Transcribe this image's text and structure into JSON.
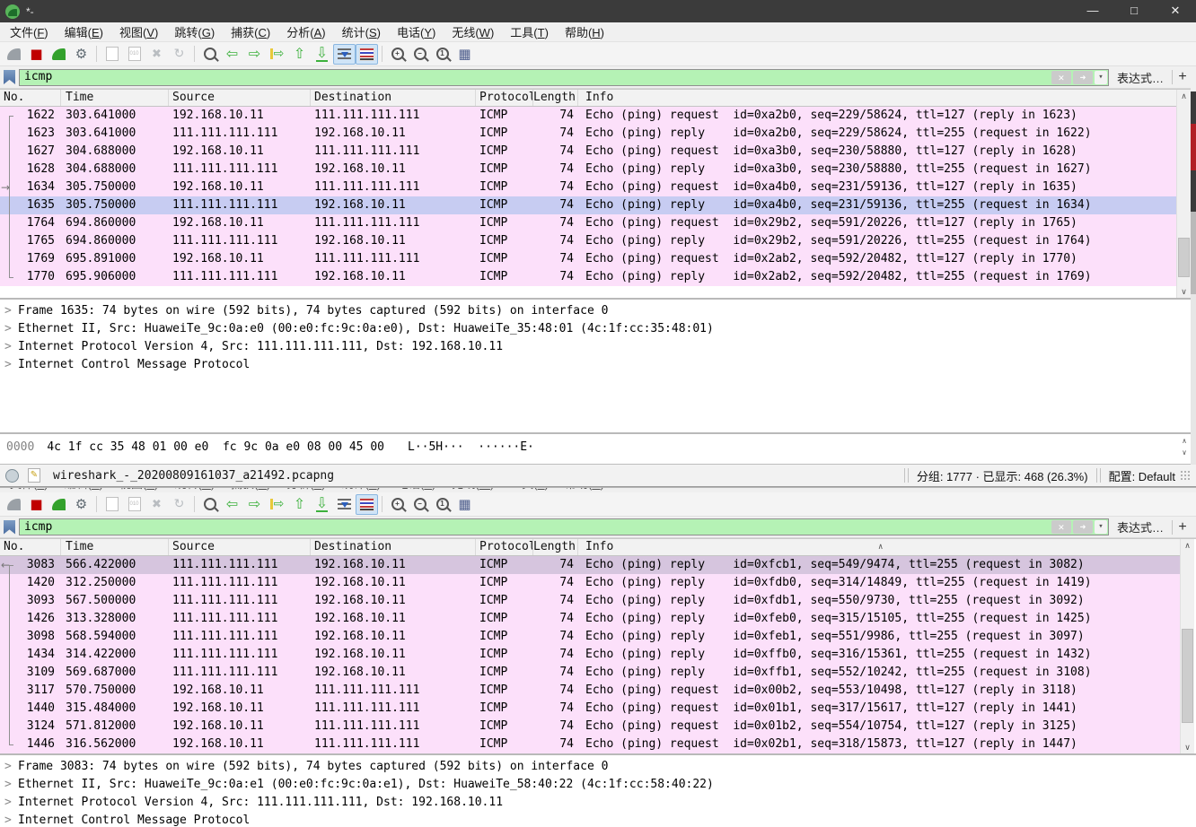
{
  "colors": {
    "filter_valid_bg": "#b5f2b5",
    "icmp_row_bg": "#fce0fa",
    "selected_row_bg": "#c7ccf2",
    "inactive_selected_row_bg": "#d6c5de",
    "titlebar_bg": "#3b3b3b"
  },
  "shared": {
    "menu": [
      "文件(F)",
      "编辑(E)",
      "视图(V)",
      "跳转(G)",
      "捕获(C)",
      "分析(A)",
      "统计(S)",
      "电话(Y)",
      "无线(W)",
      "工具(T)",
      "帮助(H)"
    ],
    "toolbar": [
      {
        "name": "start-capture-icon",
        "type": "fin",
        "color": "#9aa0a6"
      },
      {
        "name": "stop-capture-icon",
        "type": "glyph",
        "glyph": "■",
        "color": "#c00000",
        "size": 15
      },
      {
        "name": "restart-capture-icon",
        "type": "fin",
        "color": "#33a12c"
      },
      {
        "name": "capture-options-icon",
        "type": "glyph",
        "glyph": "⚙",
        "color": "#5f6a72",
        "size": 15
      },
      {
        "type": "sep"
      },
      {
        "name": "open-file-icon",
        "type": "doc",
        "label": ""
      },
      {
        "name": "save-file-icon",
        "type": "doc",
        "label": "010"
      },
      {
        "name": "close-file-icon",
        "type": "glyph",
        "glyph": "✖",
        "color": "#b9bdc1",
        "size": 13
      },
      {
        "name": "reload-icon",
        "type": "glyph",
        "glyph": "↻",
        "color": "#b9bdc1",
        "size": 14
      },
      {
        "type": "sep"
      },
      {
        "name": "find-packet-icon",
        "type": "mag",
        "label": ""
      },
      {
        "name": "previous-packet-icon",
        "type": "glyph",
        "glyph": "⇦",
        "color": "#3db13d",
        "size": 16
      },
      {
        "name": "next-packet-icon",
        "type": "glyph",
        "glyph": "⇨",
        "color": "#3db13d",
        "size": 16
      },
      {
        "name": "go-to-packet-icon",
        "type": "goto",
        "glyph": "⇨",
        "color": "#3db13d",
        "size": 14
      },
      {
        "name": "first-packet-icon",
        "type": "glyph",
        "glyph": "⇧",
        "color": "#3db13d",
        "size": 16
      },
      {
        "name": "last-packet-icon",
        "type": "glyph",
        "glyph": "⇩",
        "color": "#3db13d",
        "size": 16,
        "underbar": true
      },
      {
        "name": "auto-scroll-icon",
        "type": "autoscroll"
      },
      {
        "name": "colorize-icon",
        "type": "colorize"
      },
      {
        "type": "sep"
      },
      {
        "name": "zoom-in-icon",
        "type": "mag",
        "label": "+"
      },
      {
        "name": "zoom-out-icon",
        "type": "mag",
        "label": "−"
      },
      {
        "name": "zoom-reset-icon",
        "type": "mag",
        "label": "1"
      },
      {
        "name": "resize-columns-icon",
        "type": "glyph",
        "glyph": "▦",
        "color": "#4a5a8a",
        "size": 15
      }
    ],
    "filter_buttons": {
      "clear": "✕",
      "apply": "➜",
      "dropdown": "▾",
      "expression": "表达式…",
      "add": "+"
    },
    "columns": [
      "No.",
      "Time",
      "Source",
      "Destination",
      "Protocol",
      "Length",
      "Info"
    ],
    "expander": ">",
    "scrollbar": {
      "up": "∧",
      "down": "∨"
    },
    "scroll_hint": "∧"
  },
  "window1": {
    "titlebar": {
      "title": "*-",
      "minimize": "—",
      "maximize": "□",
      "close": "✕"
    },
    "filter": {
      "value": "icmp"
    },
    "toolbar_active": [
      "auto-scroll-icon",
      "colorize-icon"
    ],
    "packets": [
      {
        "no": "1622",
        "time": "303.641000",
        "src": "192.168.10.11",
        "dst": "111.111.111.111",
        "proto": "ICMP",
        "len": "74",
        "info": "Echo (ping) request  id=0xa2b0, seq=229/58624, ttl=127 (reply in 1623)"
      },
      {
        "no": "1623",
        "time": "303.641000",
        "src": "111.111.111.111",
        "dst": "192.168.10.11",
        "proto": "ICMP",
        "len": "74",
        "info": "Echo (ping) reply    id=0xa2b0, seq=229/58624, ttl=255 (request in 1622)"
      },
      {
        "no": "1627",
        "time": "304.688000",
        "src": "192.168.10.11",
        "dst": "111.111.111.111",
        "proto": "ICMP",
        "len": "74",
        "info": "Echo (ping) request  id=0xa3b0, seq=230/58880, ttl=127 (reply in 1628)"
      },
      {
        "no": "1628",
        "time": "304.688000",
        "src": "111.111.111.111",
        "dst": "192.168.10.11",
        "proto": "ICMP",
        "len": "74",
        "info": "Echo (ping) reply    id=0xa3b0, seq=230/58880, ttl=255 (request in 1627)"
      },
      {
        "no": "1634",
        "time": "305.750000",
        "src": "192.168.10.11",
        "dst": "111.111.111.111",
        "proto": "ICMP",
        "len": "74",
        "info": "Echo (ping) request  id=0xa4b0, seq=231/59136, ttl=127 (reply in 1635)"
      },
      {
        "no": "1635",
        "time": "305.750000",
        "src": "111.111.111.111",
        "dst": "192.168.10.11",
        "proto": "ICMP",
        "len": "74",
        "info": "Echo (ping) reply    id=0xa4b0, seq=231/59136, ttl=255 (request in 1634)"
      },
      {
        "no": "1764",
        "time": "694.860000",
        "src": "192.168.10.11",
        "dst": "111.111.111.111",
        "proto": "ICMP",
        "len": "74",
        "info": "Echo (ping) request  id=0x29b2, seq=591/20226, ttl=127 (reply in 1765)"
      },
      {
        "no": "1765",
        "time": "694.860000",
        "src": "111.111.111.111",
        "dst": "192.168.10.11",
        "proto": "ICMP",
        "len": "74",
        "info": "Echo (ping) reply    id=0x29b2, seq=591/20226, ttl=255 (request in 1764)"
      },
      {
        "no": "1769",
        "time": "695.891000",
        "src": "192.168.10.11",
        "dst": "111.111.111.111",
        "proto": "ICMP",
        "len": "74",
        "info": "Echo (ping) request  id=0x2ab2, seq=592/20482, ttl=127 (reply in 1770)"
      },
      {
        "no": "1770",
        "time": "695.906000",
        "src": "111.111.111.111",
        "dst": "192.168.10.11",
        "proto": "ICMP",
        "len": "74",
        "info": "Echo (ping) reply    id=0x2ab2, seq=592/20482, ttl=255 (request in 1769)"
      }
    ],
    "selected_no": "1635",
    "related_arrow_no": "1634",
    "related_arrow": "→",
    "details": [
      "Frame 1635: 74 bytes on wire (592 bits), 74 bytes captured (592 bits) on interface 0",
      "Ethernet II, Src: HuaweiTe_9c:0a:e0 (00:e0:fc:9c:0a:e0), Dst: HuaweiTe_35:48:01 (4c:1f:cc:35:48:01)",
      "Internet Protocol Version 4, Src: 111.111.111.111, Dst: 192.168.10.11",
      "Internet Control Message Protocol"
    ],
    "hex": {
      "offset": "0000",
      "bytes": "4c 1f cc 35 48 01 00 e0  fc 9c 0a e0 08 00 45 00",
      "ascii": "L··5H···  ······E·"
    },
    "status": {
      "filename": "wireshark_-_20200809161037_a21492.pcapng",
      "packets_info": "分组: 1777 · 已显示: 468 (26.3%)",
      "profile": "配置: Default"
    }
  },
  "window2": {
    "filter": {
      "value": "icmp"
    },
    "toolbar_active": [
      "colorize-icon"
    ],
    "packets": [
      {
        "no": "3083",
        "time": "566.422000",
        "src": "111.111.111.111",
        "dst": "192.168.10.11",
        "proto": "ICMP",
        "len": "74",
        "info": "Echo (ping) reply    id=0xfcb1, seq=549/9474, ttl=255 (request in 3082)"
      },
      {
        "no": "1420",
        "time": "312.250000",
        "src": "111.111.111.111",
        "dst": "192.168.10.11",
        "proto": "ICMP",
        "len": "74",
        "info": "Echo (ping) reply    id=0xfdb0, seq=314/14849, ttl=255 (request in 1419)"
      },
      {
        "no": "3093",
        "time": "567.500000",
        "src": "111.111.111.111",
        "dst": "192.168.10.11",
        "proto": "ICMP",
        "len": "74",
        "info": "Echo (ping) reply    id=0xfdb1, seq=550/9730, ttl=255 (request in 3092)"
      },
      {
        "no": "1426",
        "time": "313.328000",
        "src": "111.111.111.111",
        "dst": "192.168.10.11",
        "proto": "ICMP",
        "len": "74",
        "info": "Echo (ping) reply    id=0xfeb0, seq=315/15105, ttl=255 (request in 1425)"
      },
      {
        "no": "3098",
        "time": "568.594000",
        "src": "111.111.111.111",
        "dst": "192.168.10.11",
        "proto": "ICMP",
        "len": "74",
        "info": "Echo (ping) reply    id=0xfeb1, seq=551/9986, ttl=255 (request in 3097)"
      },
      {
        "no": "1434",
        "time": "314.422000",
        "src": "111.111.111.111",
        "dst": "192.168.10.11",
        "proto": "ICMP",
        "len": "74",
        "info": "Echo (ping) reply    id=0xffb0, seq=316/15361, ttl=255 (request in 1432)"
      },
      {
        "no": "3109",
        "time": "569.687000",
        "src": "111.111.111.111",
        "dst": "192.168.10.11",
        "proto": "ICMP",
        "len": "74",
        "info": "Echo (ping) reply    id=0xffb1, seq=552/10242, ttl=255 (request in 3108)"
      },
      {
        "no": "3117",
        "time": "570.750000",
        "src": "192.168.10.11",
        "dst": "111.111.111.111",
        "proto": "ICMP",
        "len": "74",
        "info": "Echo (ping) request  id=0x00b2, seq=553/10498, ttl=127 (reply in 3118)"
      },
      {
        "no": "1440",
        "time": "315.484000",
        "src": "192.168.10.11",
        "dst": "111.111.111.111",
        "proto": "ICMP",
        "len": "74",
        "info": "Echo (ping) request  id=0x01b1, seq=317/15617, ttl=127 (reply in 1441)"
      },
      {
        "no": "3124",
        "time": "571.812000",
        "src": "192.168.10.11",
        "dst": "111.111.111.111",
        "proto": "ICMP",
        "len": "74",
        "info": "Echo (ping) request  id=0x01b2, seq=554/10754, ttl=127 (reply in 3125)"
      },
      {
        "no": "1446",
        "time": "316.562000",
        "src": "192.168.10.11",
        "dst": "111.111.111.111",
        "proto": "ICMP",
        "len": "74",
        "info": "Echo (ping) request  id=0x02b1, seq=318/15873, ttl=127 (reply in 1447)"
      }
    ],
    "selected_no": "3083",
    "related_arrow_no": "3083",
    "related_arrow": "←",
    "details": [
      "Frame 3083: 74 bytes on wire (592 bits), 74 bytes captured (592 bits) on interface 0",
      "Ethernet II, Src: HuaweiTe_9c:0a:e1 (00:e0:fc:9c:0a:e1), Dst: HuaweiTe_58:40:22 (4c:1f:cc:58:40:22)",
      "Internet Protocol Version 4, Src: 111.111.111.111, Dst: 192.168.10.11",
      "Internet Control Message Protocol"
    ]
  }
}
